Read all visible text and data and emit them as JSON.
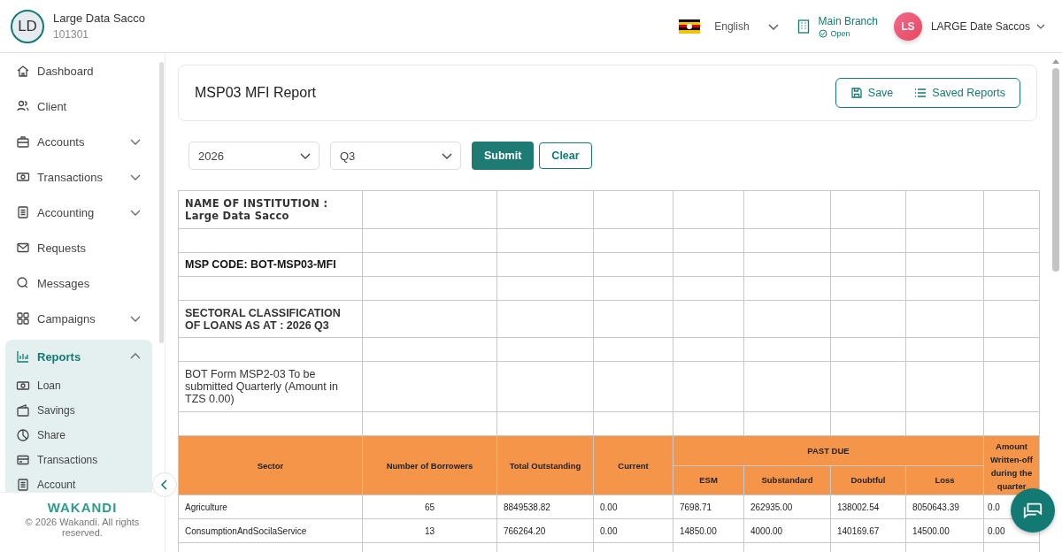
{
  "org": {
    "initials": "LD",
    "name": "Large Data Sacco",
    "code": "101301"
  },
  "topbar": {
    "language": "English",
    "branch": "Main Branch",
    "branch_status": "Open",
    "user_initials": "LS",
    "user_name": "LARGE Date Saccos"
  },
  "sidebar": {
    "items": [
      {
        "label": "Dashboard",
        "expandable": false
      },
      {
        "label": "Client",
        "expandable": false
      },
      {
        "label": "Accounts",
        "expandable": true,
        "expanded": false
      },
      {
        "label": "Transactions",
        "expandable": true,
        "expanded": false
      },
      {
        "label": "Accounting",
        "expandable": true,
        "expanded": false
      },
      {
        "label": "Requests",
        "expandable": false
      },
      {
        "label": "Messages",
        "expandable": false
      },
      {
        "label": "Campaigns",
        "expandable": true,
        "expanded": false
      },
      {
        "label": "Reports",
        "expandable": true,
        "expanded": true,
        "children": [
          {
            "label": "Loan"
          },
          {
            "label": "Savings"
          },
          {
            "label": "Share"
          },
          {
            "label": "Transactions"
          },
          {
            "label": "Account"
          }
        ]
      }
    ],
    "brand": "WAKANDI",
    "copyright": "© 2026 Wakandi. All rights reserved."
  },
  "page": {
    "title": "MSP03 MFI Report",
    "buttons": [
      "Save",
      "Saved Reports"
    ]
  },
  "filters": {
    "year": "2026",
    "quarter": "Q3",
    "submit": "Submit",
    "clear": "Clear"
  },
  "report": {
    "info_rows": [
      {
        "kind": "institution",
        "text": "NAME OF INSTITUTION : Large Data Sacco"
      },
      {
        "kind": "blank"
      },
      {
        "kind": "code",
        "text": "MSP CODE: BOT-MSP03-MFI"
      },
      {
        "kind": "blank"
      },
      {
        "kind": "heading",
        "text": "SECTORAL CLASSIFICATION OF LOANS AS AT : 2026 Q3"
      },
      {
        "kind": "blank"
      },
      {
        "kind": "note",
        "text": "BOT Form MSP2-03 To be submitted Quarterly (Amount in TZS 0.00)"
      },
      {
        "kind": "blank"
      }
    ],
    "columns": [
      "Sector",
      "Number of Borrowers",
      "Total Outstanding",
      "Current"
    ],
    "group_heading": "PAST DUE",
    "group_columns": [
      "ESM",
      "Substandard",
      "Doubtful",
      "Loss"
    ],
    "last_column": "Amount Written-off during the quarter",
    "rows": [
      [
        "Agriculture",
        "65",
        "8849538.82",
        "0.00",
        "7698.71",
        "262935.00",
        "138002.54",
        "8050643.39",
        "0.0"
      ],
      [
        "ConsumptionAndSocilaService",
        "13",
        "766264.20",
        "0.00",
        "14850.00",
        "4000.00",
        "140169.67",
        "14500.00",
        "0.00"
      ]
    ]
  }
}
